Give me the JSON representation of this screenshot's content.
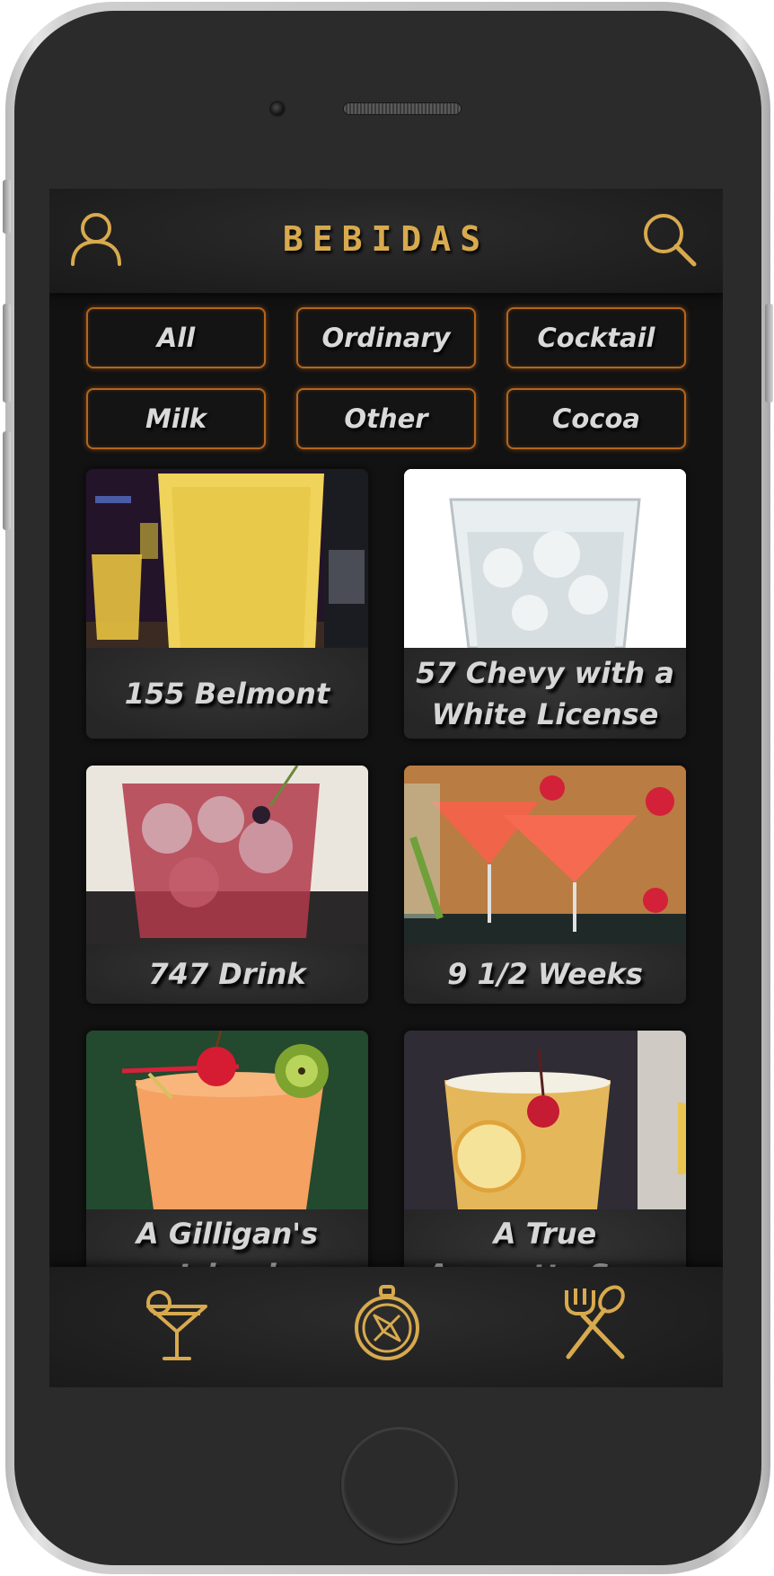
{
  "header": {
    "title": "BEBIDAS",
    "left_icon": "user-icon",
    "right_icon": "search-icon"
  },
  "filters": [
    {
      "label": "All"
    },
    {
      "label": "Ordinary"
    },
    {
      "label": "Cocktail"
    },
    {
      "label": "Milk"
    },
    {
      "label": "Other"
    },
    {
      "label": "Cocoa"
    }
  ],
  "drinks": [
    {
      "name": "155 Belmont"
    },
    {
      "name": "57 Chevy with a White License"
    },
    {
      "name": "747 Drink"
    },
    {
      "name": "9 1/2 Weeks"
    },
    {
      "name": "A Gilligan's Island"
    },
    {
      "name": "A True Amaretto Sour"
    }
  ],
  "tabbar": {
    "items": [
      {
        "icon": "cocktail-glass-icon"
      },
      {
        "icon": "compass-icon"
      },
      {
        "icon": "fork-spoon-icon"
      }
    ]
  },
  "colors": {
    "accent": "#d8aa4e",
    "chip_border": "#b5651d",
    "background": "#121212"
  }
}
